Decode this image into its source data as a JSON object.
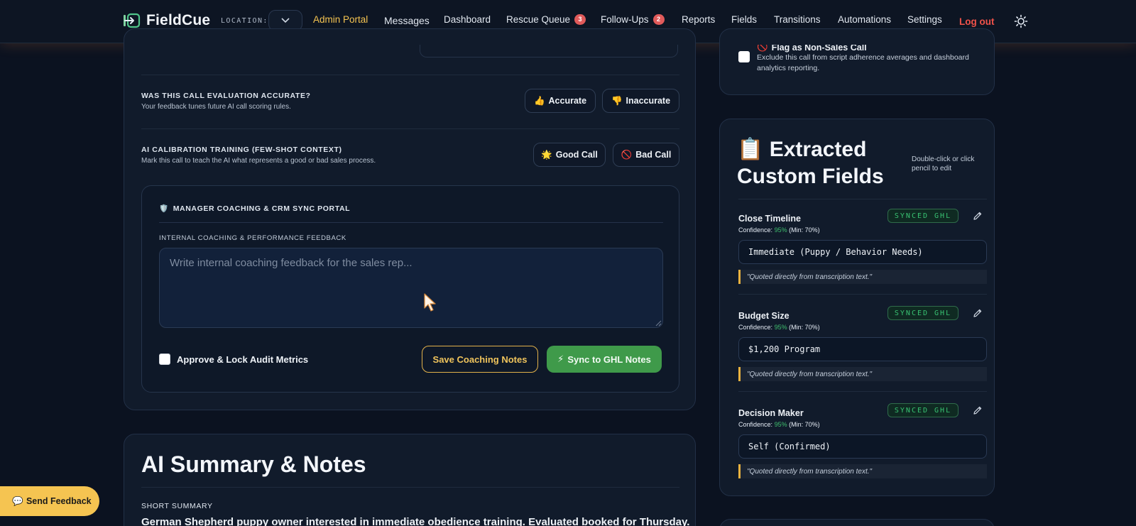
{
  "nav": {
    "brand": "FieldCue",
    "location_label": "LOCATION:",
    "location_value": "",
    "items": [
      {
        "label": "Admin Portal",
        "active": true
      },
      {
        "label": "Messages"
      },
      {
        "label": "Dashboard"
      },
      {
        "label": "Rescue Queue",
        "badge": "3"
      },
      {
        "label": "Follow-Ups",
        "badge": "2"
      },
      {
        "label": "Reports"
      },
      {
        "label": "Fields"
      },
      {
        "label": "Transitions"
      },
      {
        "label": "Automations"
      },
      {
        "label": "Settings"
      },
      {
        "label": "Log out"
      }
    ],
    "theme_icon": "sun-icon"
  },
  "evaluation": {
    "title": "WAS THIS CALL EVALUATION ACCURATE?",
    "subtitle": "Your feedback tunes future AI call scoring rules.",
    "accurate_label": "Accurate",
    "inaccurate_label": "Inaccurate",
    "accurate_icon": "👍",
    "inaccurate_icon": "👎"
  },
  "calibration": {
    "title": "AI CALIBRATION TRAINING (FEW-SHOT CONTEXT)",
    "subtitle": "Mark this call to teach the AI what represents a good or bad sales process.",
    "good_label": "Good Call",
    "bad_label": "Bad Call",
    "good_icon": "🌟",
    "bad_icon": "🚫"
  },
  "portal": {
    "icon": "🛡️",
    "title": "MANAGER COACHING & CRM SYNC PORTAL",
    "feedback_label": "INTERNAL COACHING & PERFORMANCE FEEDBACK",
    "feedback_placeholder": "Write internal coaching feedback for the sales rep...",
    "feedback_value": "",
    "approve_label": "Approve & Lock Audit Metrics",
    "approve_checked": false,
    "save_label": "Save Coaching Notes",
    "sync_icon": "⚡",
    "sync_label": "Sync to GHL Notes"
  },
  "summary": {
    "title": "AI Summary & Notes",
    "short_label": "SHORT SUMMARY",
    "short_text": "German Shepherd puppy owner interested in immediate obedience training. Evaluated booked for Thursday."
  },
  "flag": {
    "icon": "🚫",
    "title": "Flag as Non-Sales Call",
    "checked": false,
    "description": "Exclude this call from script adherence averages and dashboard analytics reporting."
  },
  "custom_fields": {
    "icon": "📋",
    "title": "Extracted Custom Fields",
    "hint": "Double-click or click pencil to edit",
    "fields": [
      {
        "name": "Close Timeline",
        "confidence_label": "Confidence:",
        "confidence": "95%",
        "min": "(Min: 70%)",
        "status": "SYNCED GHL",
        "value": "Immediate (Puppy / Behavior Needs)",
        "quote": "\"Quoted directly from transcription text.\""
      },
      {
        "name": "Budget Size",
        "confidence_label": "Confidence:",
        "confidence": "95%",
        "min": "(Min: 70%)",
        "status": "SYNCED GHL",
        "value": "$1,200 Program",
        "quote": "\"Quoted directly from transcription text.\""
      },
      {
        "name": "Decision Maker",
        "confidence_label": "Confidence:",
        "confidence": "95%",
        "min": "(Min: 70%)",
        "status": "SYNCED GHL",
        "value": "Self (Confirmed)",
        "quote": "\"Quoted directly from transcription text.\""
      }
    ]
  },
  "feedback_widget": {
    "icon": "💬",
    "label": "Send Feedback"
  },
  "colors": {
    "accent": "#f5c451",
    "success": "#3f9a4a",
    "danger": "#f0524a",
    "background": "#0b1220"
  }
}
